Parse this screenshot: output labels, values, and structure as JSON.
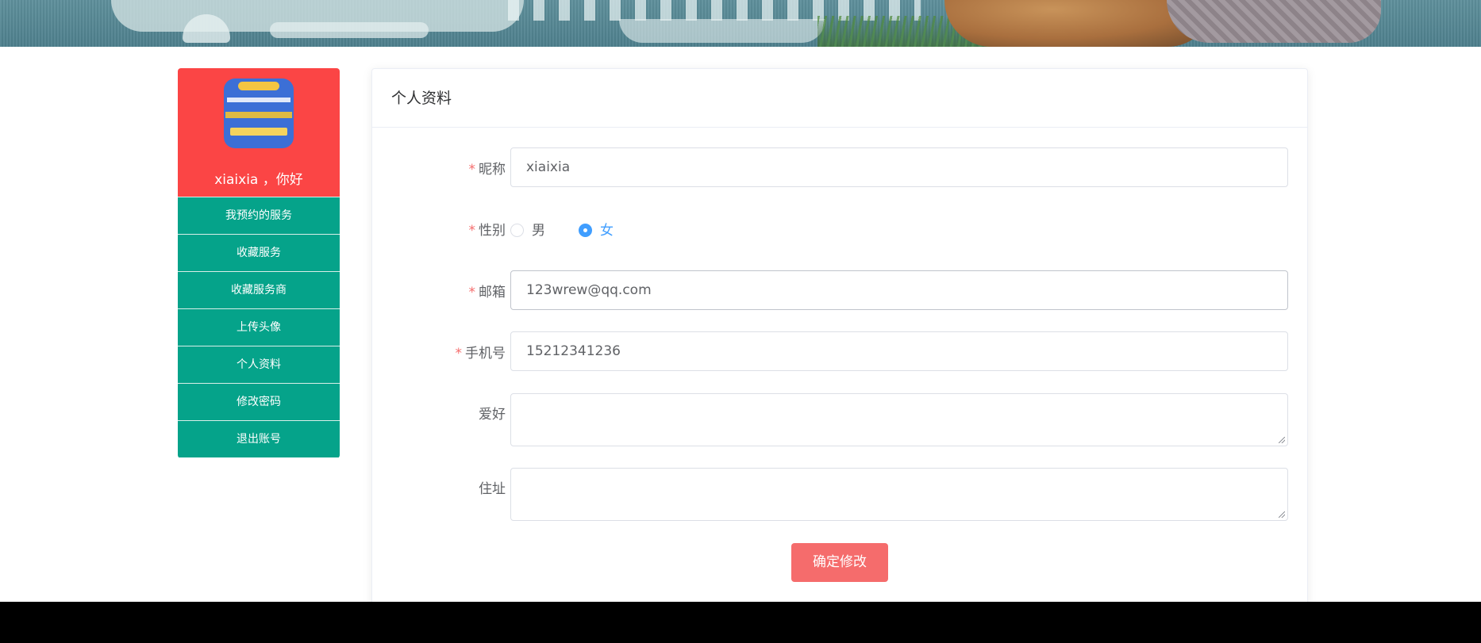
{
  "sidebar": {
    "greeting_user": "xiaixia",
    "greeting_suffix": "，你好",
    "items": [
      {
        "label": "我预约的服务"
      },
      {
        "label": "收藏服务"
      },
      {
        "label": "收藏服务商"
      },
      {
        "label": "上传头像"
      },
      {
        "label": "个人资料"
      },
      {
        "label": "修改密码"
      },
      {
        "label": "退出账号"
      }
    ]
  },
  "form": {
    "title": "个人资料",
    "nickname": {
      "label": "昵称",
      "value": "xiaixia"
    },
    "gender": {
      "label": "性别",
      "options": [
        "男",
        "女"
      ],
      "selected": "女"
    },
    "email": {
      "label": "邮箱",
      "value": "123wrew@qq.com"
    },
    "phone": {
      "label": "手机号",
      "value": "15212341236"
    },
    "hobby": {
      "label": "爱好",
      "value": ""
    },
    "address": {
      "label": "住址",
      "value": ""
    },
    "submit_label": "确定修改"
  },
  "colors": {
    "sidebar_header": "#fb4545",
    "menu_bg": "#05a38a",
    "required_star": "#f56c6c",
    "radio_checked": "#409eff",
    "submit_bg": "#f56c6c",
    "footer_bg": "#000000"
  }
}
